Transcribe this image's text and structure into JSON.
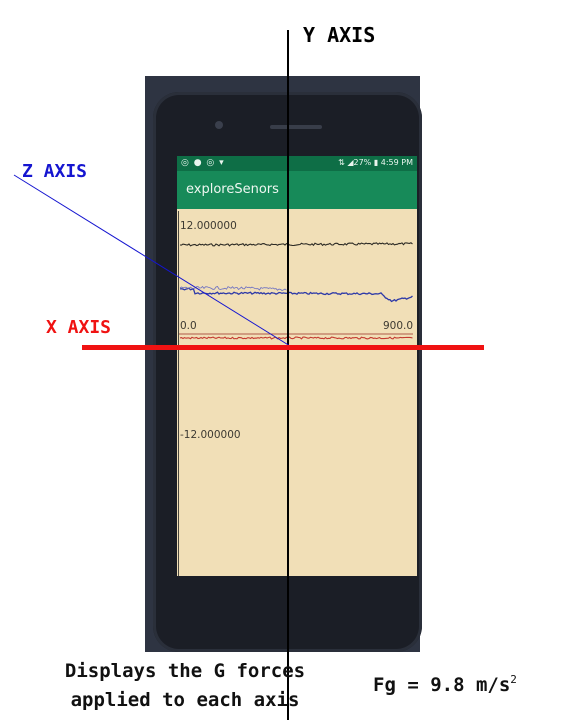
{
  "annotations": {
    "y_axis_label": "Y AXIS",
    "z_axis_label": "Z AXIS",
    "x_axis_label": "X AXIS",
    "caption_line1": "Displays the G forces",
    "caption_line2": "applied to each axis",
    "formula_text": "Fg = 9.8 m/s",
    "formula_exponent": "2",
    "colors": {
      "y": "#000000",
      "z": "#1515d0",
      "x": "#f01212"
    }
  },
  "phone": {
    "status_bar": {
      "left_icons": "◎ ● ◎ ▾",
      "right": "⇅ ◢27% ▮ 4:59 PM"
    },
    "app_title": "exploreSenors",
    "plot": {
      "y_max_label": "12.000000",
      "y_min_label": "-12.000000",
      "x_min_label": "0.0",
      "x_max_label": "900.0",
      "series_colors": {
        "top": "#2c2a24",
        "middle": "#2e3aa8",
        "bottom": "#c43a30"
      }
    }
  }
}
